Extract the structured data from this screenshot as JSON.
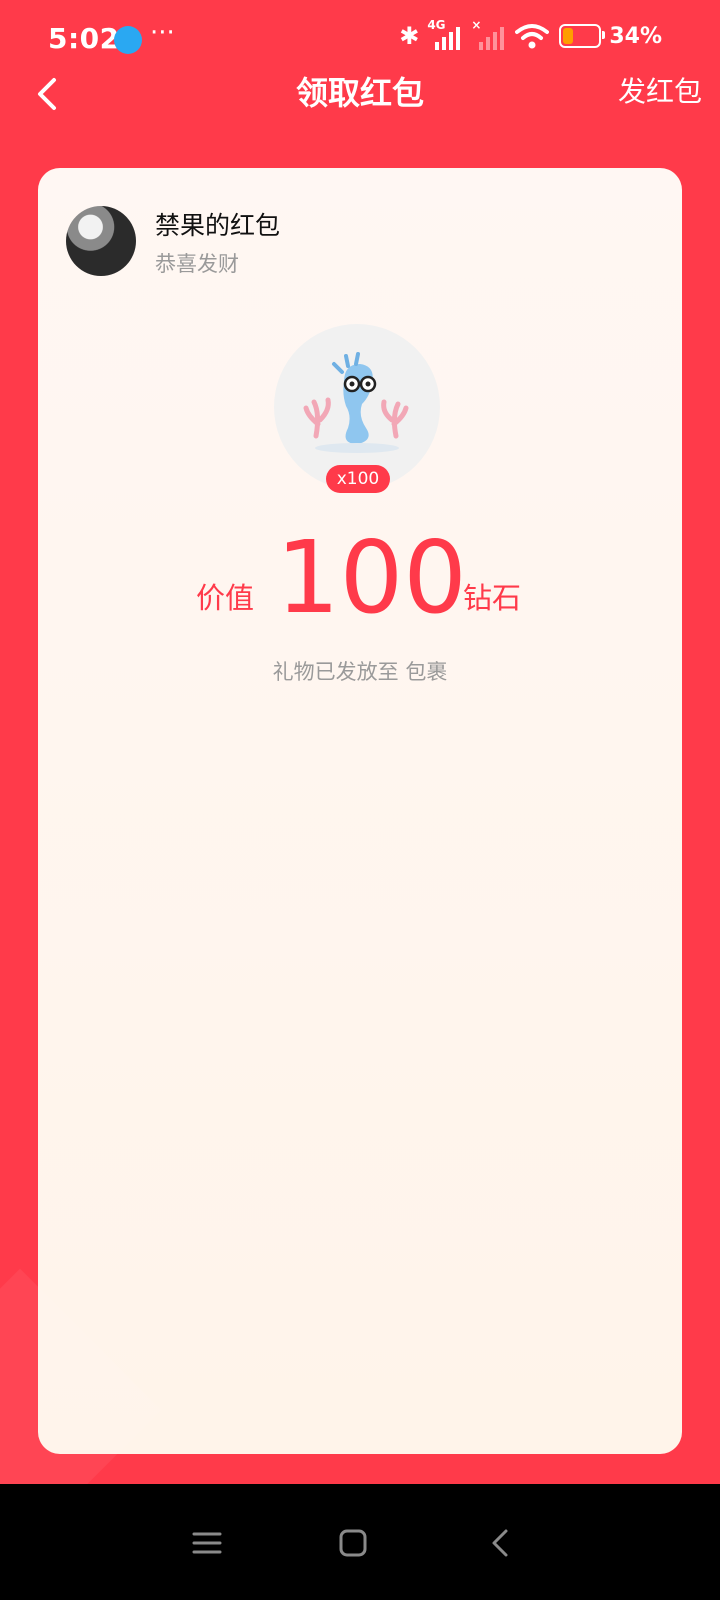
{
  "status_bar": {
    "time": "5:02",
    "more": "···",
    "network": "4G",
    "battery": "34%"
  },
  "header": {
    "title": "领取红包",
    "send_label": "发红包"
  },
  "card": {
    "sender_name": "禁果的红包",
    "greeting": "恭喜发财",
    "gift_count": "x100",
    "value_label": "价值",
    "value_amount": "100",
    "value_unit": "钻石",
    "delivery_note": "礼物已发放至 包裹"
  },
  "colors": {
    "brand": "#FF3A4A",
    "card_bg": "#FFF6EF"
  },
  "icons": [
    "back-arrow-icon",
    "bluetooth-icon",
    "signal-icon",
    "wifi-icon",
    "battery-icon",
    "menu-icon",
    "home-icon",
    "back-icon"
  ]
}
